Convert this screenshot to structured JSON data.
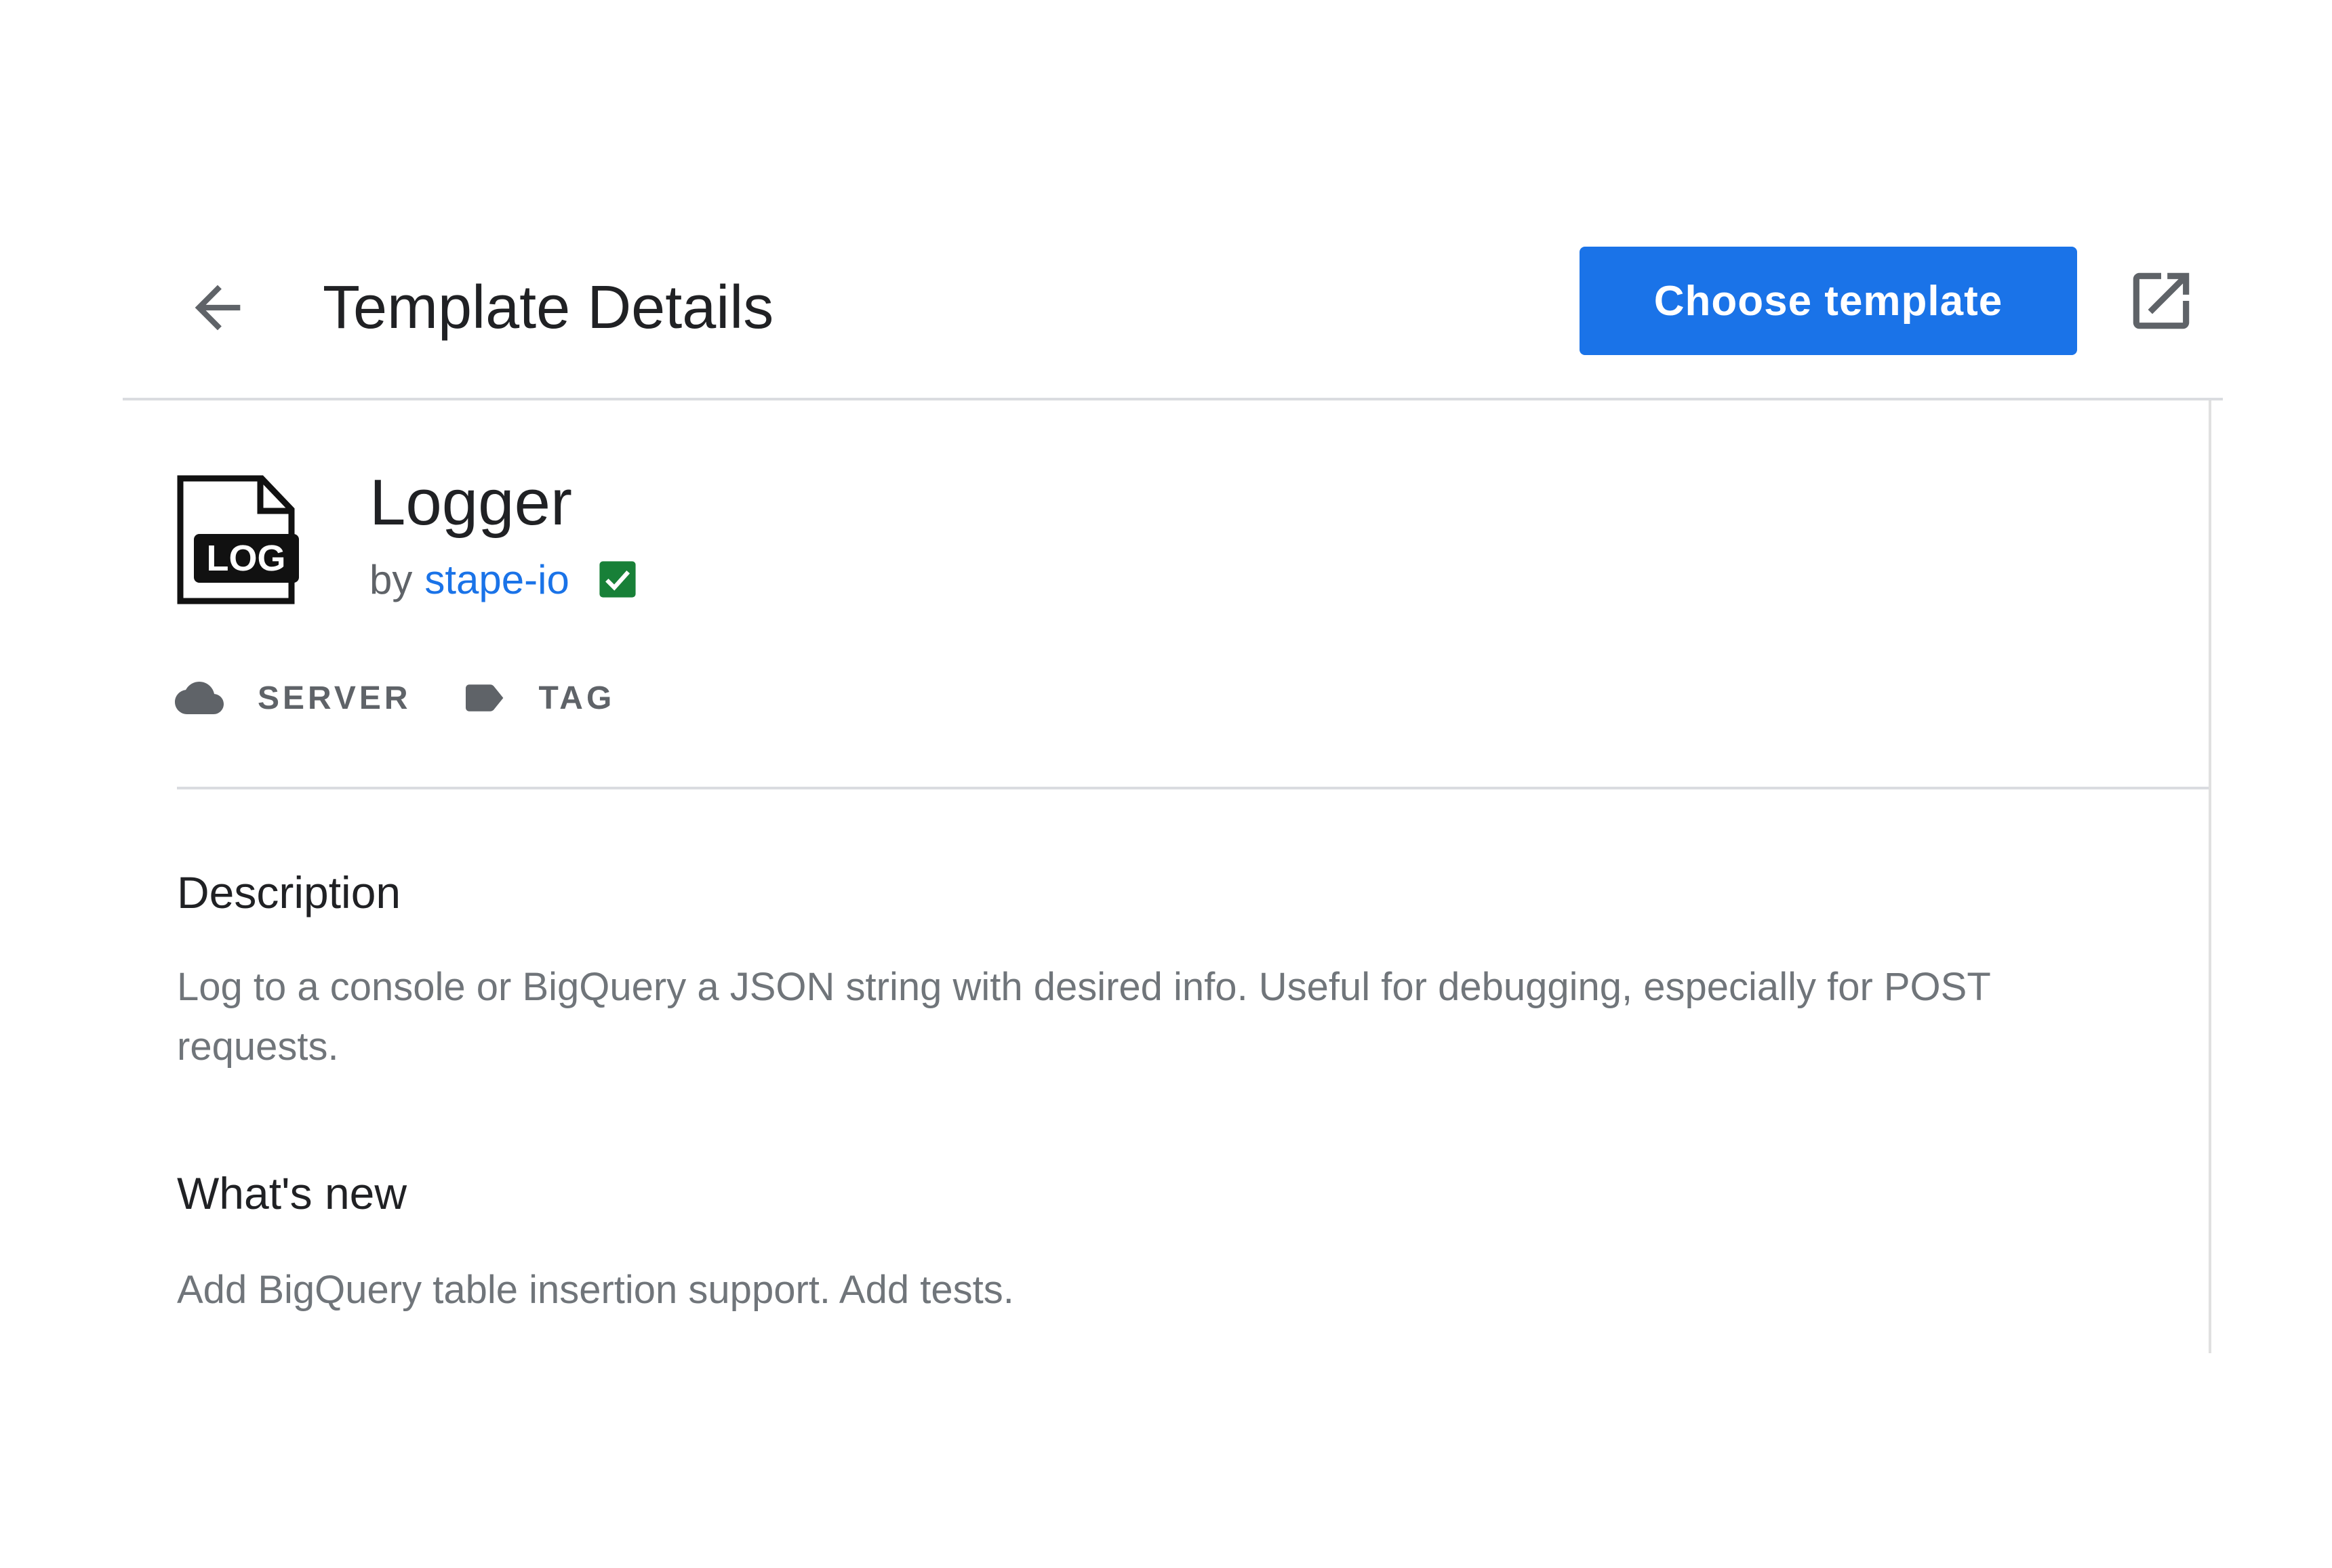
{
  "header": {
    "title": "Template Details",
    "primary_action_label": "Choose template",
    "back_icon": "arrow-left-icon",
    "external_icon": "open-in-new-icon"
  },
  "template": {
    "icon_label": "LOG",
    "name": "Logger",
    "author_prefix": "by",
    "author": "stape-io",
    "verified_color": "#188038",
    "chips": [
      {
        "icon": "cloud-icon",
        "label": "SERVER"
      },
      {
        "icon": "label-icon",
        "label": "TAG"
      }
    ]
  },
  "sections": {
    "description": {
      "heading": "Description",
      "body": "Log to a console or BigQuery a JSON string with desired info. Useful for debugging, especially for POST requests."
    },
    "whats_new": {
      "heading": "What's new",
      "body": "Add BigQuery table insertion support. Add tests."
    }
  },
  "colors": {
    "primary": "#1a73e8",
    "text_primary": "#202124",
    "text_secondary": "#5f6368",
    "divider": "#dadce0"
  }
}
